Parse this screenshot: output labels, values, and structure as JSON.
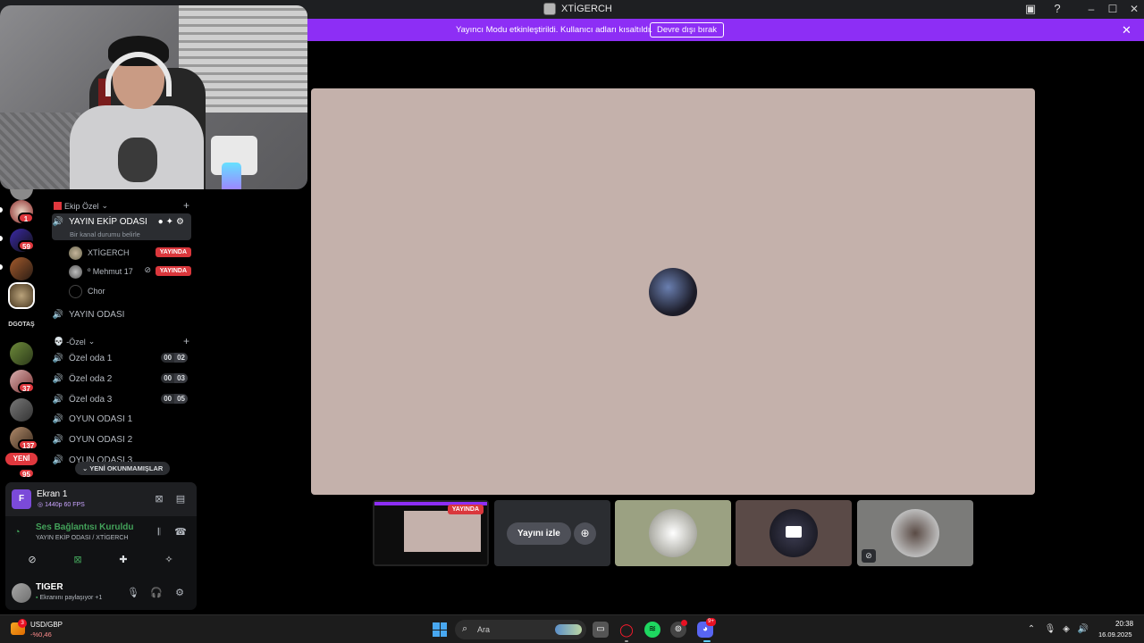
{
  "window": {
    "title": "XTİGERCH"
  },
  "banner": {
    "text": "Yayıncı Modu etkinleştirildi. Kullanıcı adları kısaltıldı.",
    "button_label": "Devre dışı bırak"
  },
  "servers": [
    {
      "badge": ""
    },
    {
      "badge": "1"
    },
    {
      "badge": "59"
    },
    {
      "badge": ""
    },
    {
      "badge": ""
    },
    {
      "label": "DGOTAŞ"
    },
    {
      "badge": ""
    },
    {
      "badge": "37"
    },
    {
      "badge": ""
    },
    {
      "badge": "137"
    },
    {
      "badge": "95"
    }
  ],
  "new_pill": "YENİ",
  "channels": {
    "category1": "Ekip Özel",
    "active_channel": {
      "name": "YAYIN EKİP ODASI",
      "status_hint": "Bir kanal durumu belirle"
    },
    "members": [
      {
        "name": "XTİGERCH",
        "badge": "YAYINDA"
      },
      {
        "name": "º Mehmut 17",
        "badge": "YAYINDA"
      },
      {
        "name": "Chor",
        "badge": ""
      }
    ],
    "channel_yayin": "YAYIN ODASI",
    "category2": "-Özel",
    "rooms": [
      {
        "name": "Özel oda 1",
        "c1": "00",
        "c2": "02"
      },
      {
        "name": "Özel oda 2",
        "c1": "00",
        "c2": "03"
      },
      {
        "name": "Özel oda 3",
        "c1": "00",
        "c2": "05"
      },
      {
        "name": "OYUN ODASI 1"
      },
      {
        "name": "OYUN ODASI 2"
      },
      {
        "name": "OYUN ODASI 3"
      }
    ],
    "unread_pill": "YENİ OKUNMAMIŞLAR"
  },
  "share": {
    "avatar_letter": "F",
    "title": "Ekran 1",
    "sub": "1440p 60 FPS"
  },
  "voice": {
    "title": "Ses Bağlantısı Kuruldu",
    "sub": "YAYIN EKİP ODASI / XTİGERCH"
  },
  "user": {
    "name": "TIGER",
    "status": "Ekranını paylaşıyor +1"
  },
  "tiles": {
    "live_label": "YAYINDA",
    "watch_label": "Yayını izle"
  },
  "taskbar": {
    "widget_badge": "3",
    "widget_title": "USD/GBP",
    "widget_value": "-%0,46",
    "search_placeholder": "Ara",
    "discord_badge": "9+",
    "time": "20:38",
    "date": "16.09.2025"
  },
  "colors": {
    "banner": "#8d2ef5",
    "stage": "#c4b1ab",
    "live": "#da373c",
    "connected": "#43a25a"
  }
}
